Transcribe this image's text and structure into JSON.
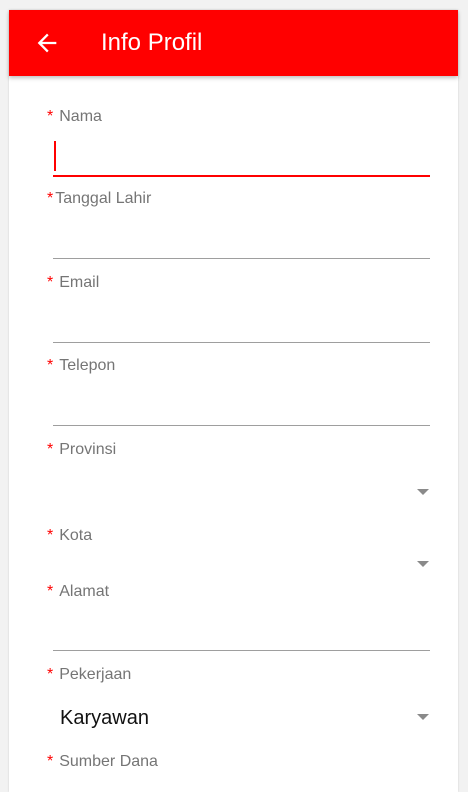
{
  "header": {
    "title": "Info Profil",
    "back_icon": "back-arrow-icon"
  },
  "form": {
    "required_mark": "*",
    "nama": {
      "label": "Nama",
      "value": ""
    },
    "tanggal_lahir": {
      "label": "Tanggal Lahir",
      "value": ""
    },
    "email": {
      "label": "Email",
      "value": ""
    },
    "telepon": {
      "label": "Telepon",
      "value": ""
    },
    "provinsi": {
      "label": "Provinsi",
      "value": ""
    },
    "kota": {
      "label": "Kota",
      "value": ""
    },
    "alamat": {
      "label": "Alamat",
      "value": ""
    },
    "pekerjaan": {
      "label": "Pekerjaan",
      "value": "Karyawan"
    },
    "sumber_dana": {
      "label": "Sumber Dana"
    }
  },
  "colors": {
    "accent": "#ff0000",
    "label": "#757575",
    "line": "#9e9e9e"
  }
}
